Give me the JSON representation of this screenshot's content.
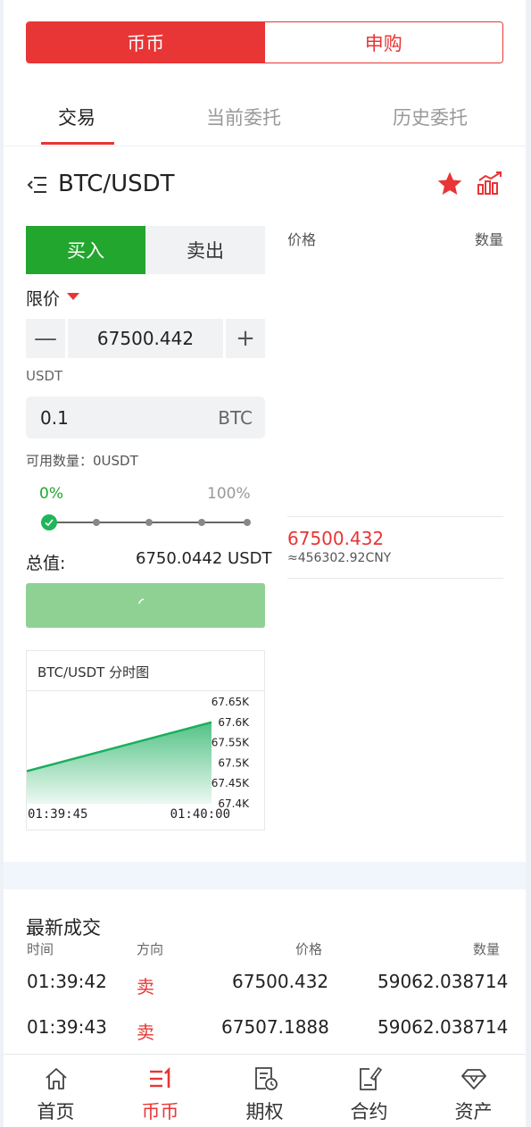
{
  "top_tabs": [
    {
      "label": "币币",
      "active": true
    },
    {
      "label": "申购",
      "active": false
    }
  ],
  "sub_tabs": [
    {
      "label": "交易",
      "active": true
    },
    {
      "label": "当前委托",
      "active": false
    },
    {
      "label": "历史委托",
      "active": false
    }
  ],
  "pair": {
    "name": "BTC/USDT",
    "favorited": true
  },
  "order_form": {
    "buy_label": "买入",
    "sell_label": "卖出",
    "order_type": "限价",
    "price": "67500.442",
    "price_unit": "USDT",
    "quantity": "0.1",
    "quantity_unit": "BTC",
    "available": "可用数量：0USDT",
    "pct_min": "0%",
    "pct_max": "100%",
    "slider_value": 0,
    "total_label": "总值:",
    "total_value": "6750.0442 USDT"
  },
  "mini_chart": {
    "title": "BTC/USDT 分时图",
    "time_start": "01:39:45",
    "time_end": "01:40:00",
    "y_ticks": [
      "67.65K",
      "67.6K",
      "67.55K",
      "67.5K",
      "67.45K",
      "67.4K"
    ]
  },
  "chart_data": {
    "type": "area",
    "title": "BTC/USDT 分时图",
    "x": [
      "01:39:45",
      "01:40:00"
    ],
    "series": [
      {
        "values": [
          67.48,
          67.6
        ]
      }
    ],
    "y_unit": "K",
    "ylim": [
      67.4,
      67.65
    ],
    "yticks": [
      67.4,
      67.45,
      67.5,
      67.55,
      67.6,
      67.65
    ],
    "grid": false,
    "color": "#1aae5e"
  },
  "order_book": {
    "header_price": "价格",
    "header_qty": "数量",
    "last_price": "67500.432",
    "last_price_cny": "≈456302.92CNY"
  },
  "recent_trades": {
    "title": "最新成交",
    "headers": {
      "time": "时间",
      "direction": "方向",
      "price": "价格",
      "qty": "数量"
    },
    "rows": [
      {
        "time": "01:39:42",
        "direction": "卖",
        "price": "67500.432",
        "qty": "59062.038714"
      },
      {
        "time": "01:39:43",
        "direction": "卖",
        "price": "67507.1888",
        "qty": "59062.038714"
      }
    ]
  },
  "nav": [
    {
      "label": "首页",
      "icon": "home-icon",
      "active": false
    },
    {
      "label": "币币",
      "icon": "exchange-icon",
      "active": true
    },
    {
      "label": "期权",
      "icon": "options-icon",
      "active": false
    },
    {
      "label": "合约",
      "icon": "contract-icon",
      "active": false
    },
    {
      "label": "资产",
      "icon": "diamond-icon",
      "active": false
    }
  ],
  "colors": {
    "accent": "#e83535",
    "buy": "#22a62e",
    "chart_line": "#1aae5e"
  }
}
